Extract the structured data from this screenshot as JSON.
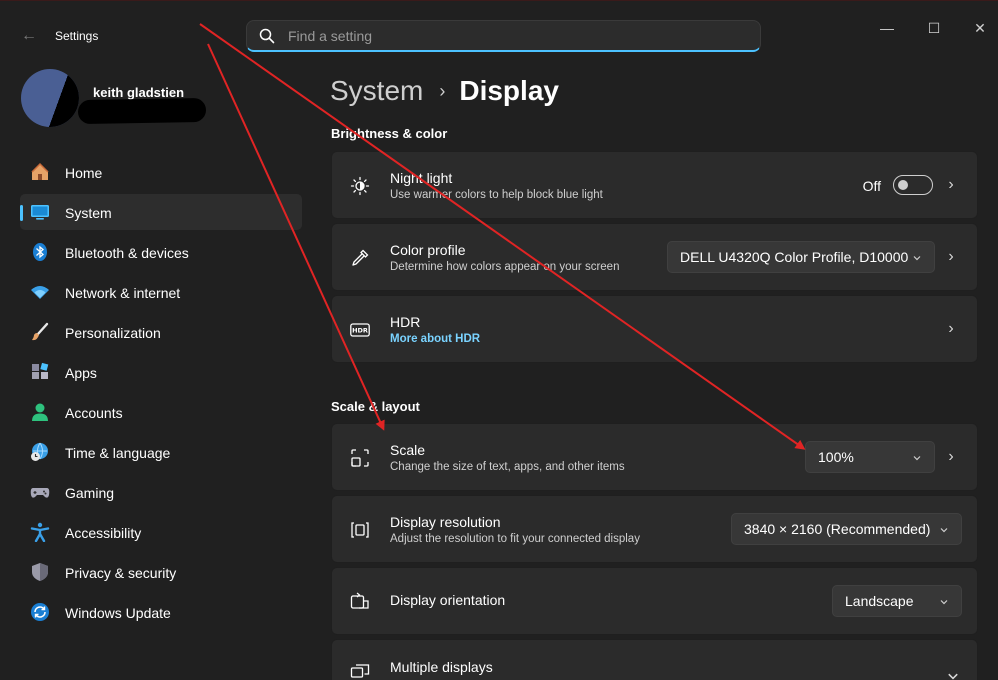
{
  "titlebar": {
    "app_title": "Settings",
    "back_icon": "back-arrow-icon",
    "minimize_glyph": "—",
    "maximize_glyph": "☐",
    "close_glyph": "✕"
  },
  "search": {
    "placeholder": "Find a setting"
  },
  "profile": {
    "name": "keith gladstien"
  },
  "nav": {
    "items": [
      {
        "label": "Home",
        "icon": "home-icon"
      },
      {
        "label": "System",
        "icon": "system-icon",
        "active": true
      },
      {
        "label": "Bluetooth & devices",
        "icon": "bluetooth-icon"
      },
      {
        "label": "Network & internet",
        "icon": "wifi-icon"
      },
      {
        "label": "Personalization",
        "icon": "brush-icon"
      },
      {
        "label": "Apps",
        "icon": "apps-icon"
      },
      {
        "label": "Accounts",
        "icon": "accounts-icon"
      },
      {
        "label": "Time & language",
        "icon": "globe-clock-icon"
      },
      {
        "label": "Gaming",
        "icon": "gamepad-icon"
      },
      {
        "label": "Accessibility",
        "icon": "accessibility-icon"
      },
      {
        "label": "Privacy & security",
        "icon": "shield-icon"
      },
      {
        "label": "Windows Update",
        "icon": "update-icon"
      }
    ]
  },
  "breadcrumb": {
    "parent": "System",
    "separator": "›",
    "current": "Display"
  },
  "sections": {
    "brightness": "Brightness & color",
    "scale_layout": "Scale & layout"
  },
  "cards": {
    "night_light": {
      "title": "Night light",
      "sub": "Use warmer colors to help block blue light",
      "state": "Off"
    },
    "color_profile": {
      "title": "Color profile",
      "sub": "Determine how colors appear on your screen",
      "value": "DELL U4320Q Color Profile, D10000"
    },
    "hdr": {
      "title": "HDR",
      "sub": "More about HDR"
    },
    "scale": {
      "title": "Scale",
      "sub": "Change the size of text, apps, and other items",
      "value": "100%"
    },
    "resolution": {
      "title": "Display resolution",
      "sub": "Adjust the resolution to fit your connected display",
      "value": "3840 × 2160 (Recommended)"
    },
    "orientation": {
      "title": "Display orientation",
      "value": "Landscape"
    },
    "multiple": {
      "title": "Multiple displays"
    }
  },
  "colors": {
    "accent": "#4cc2ff",
    "background": "#202020",
    "card": "#2b2b2b",
    "annotation_arrow": "#e02424"
  }
}
